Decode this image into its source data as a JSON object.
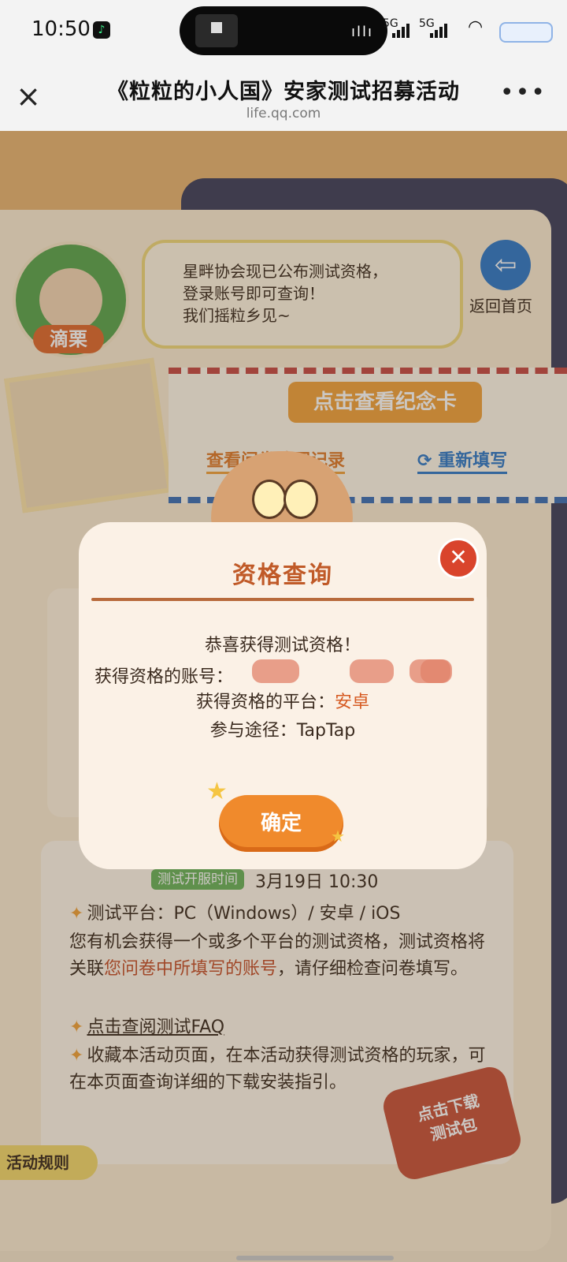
{
  "status_bar": {
    "time": "10:50",
    "network_1": "5G",
    "network_2": "5G"
  },
  "nav": {
    "title": "《粒粒的小人国》安家测试招募活动",
    "url": "life.qq.com",
    "close_icon": "close-icon",
    "more_icon": "more-icon"
  },
  "page": {
    "avatar_name": "滴栗",
    "bubble_lines": [
      "星畔协会现已公布测试资格，",
      "登录账号即可查询！",
      "我们摇粒乡见~"
    ],
    "back_home_label": "返回首页",
    "memorial_button": "点击查看纪念卡",
    "view_record": "查看问卷填写记录",
    "refill": "重新填写",
    "test_tag": "测试开服时间",
    "test_time": "3月19日  10:30",
    "line_platform": "测试平台：PC（Windows）/ 安卓 / iOS",
    "line_qualify_a": "您有机会获得一个或多个平台的测试资格，测试资格将关联",
    "line_qualify_hl": "您问卷中所填写的账号",
    "line_qualify_b": "，请仔细检查问卷填写。",
    "line_faq": "点击查阅测试FAQ",
    "line_bookmark": "收藏本活动页面，在本活动获得测试资格的玩家，可在本页面查询详细的下载安装指引。",
    "rules_tab": "活动规则",
    "download_badge_1": "点击下载",
    "download_badge_2": "测试包"
  },
  "modal": {
    "title": "资格查询",
    "congrats": "恭喜获得测试资格！",
    "account_label": "获得资格的账号：",
    "platform_label": "获得资格的平台：",
    "platform_value": "安卓",
    "route_label": "参与途径：",
    "route_value": "TapTap",
    "confirm": "确定"
  }
}
